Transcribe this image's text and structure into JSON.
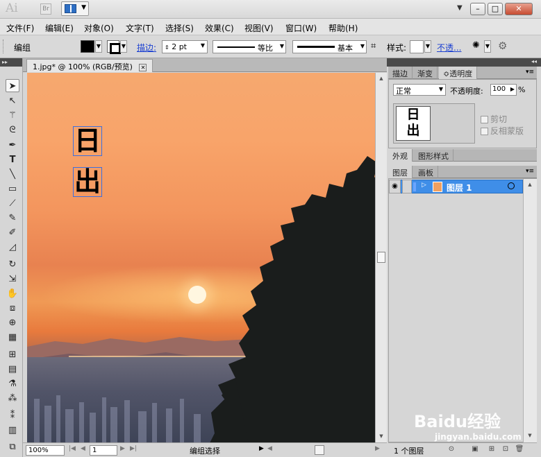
{
  "app": {
    "logo": "Ai",
    "bridge_label": "Br"
  },
  "menu": [
    "文件(F)",
    "编辑(E)",
    "对象(O)",
    "文字(T)",
    "选择(S)",
    "效果(C)",
    "视图(V)",
    "窗口(W)",
    "帮助(H)"
  ],
  "control_bar": {
    "selection_type": "编组",
    "stroke_label": "描边:",
    "stroke_weight": "2 pt",
    "profile_label": "等比",
    "brush_label": "基本",
    "style_label": "样式:",
    "opacity_link": "不透..."
  },
  "document": {
    "tab_title": "1.jpg* @ 100% (RGB/预览)",
    "tab_close": "⊠",
    "zoom": "100%",
    "artboard": "1",
    "status_text": "编组选择"
  },
  "canvas_text": {
    "char1": "日",
    "char2": "出"
  },
  "transparency_panel": {
    "tabs": [
      "描边",
      "渐变",
      "≎透明度"
    ],
    "blend_mode": "正常",
    "opacity_label": "不透明度:",
    "opacity_value": "100",
    "opacity_unit": "%",
    "clip_label": "剪切",
    "invert_mask_label": "反相蒙版"
  },
  "appearance_panel": {
    "tabs": [
      "外观",
      "图形样式"
    ]
  },
  "layers_panel": {
    "tabs": [
      "图层",
      "画板"
    ],
    "layer_name": "图层 1",
    "status": "1 个图层"
  },
  "watermark": {
    "brand": "Baidu经验",
    "url": "jingyan.baidu.com"
  }
}
